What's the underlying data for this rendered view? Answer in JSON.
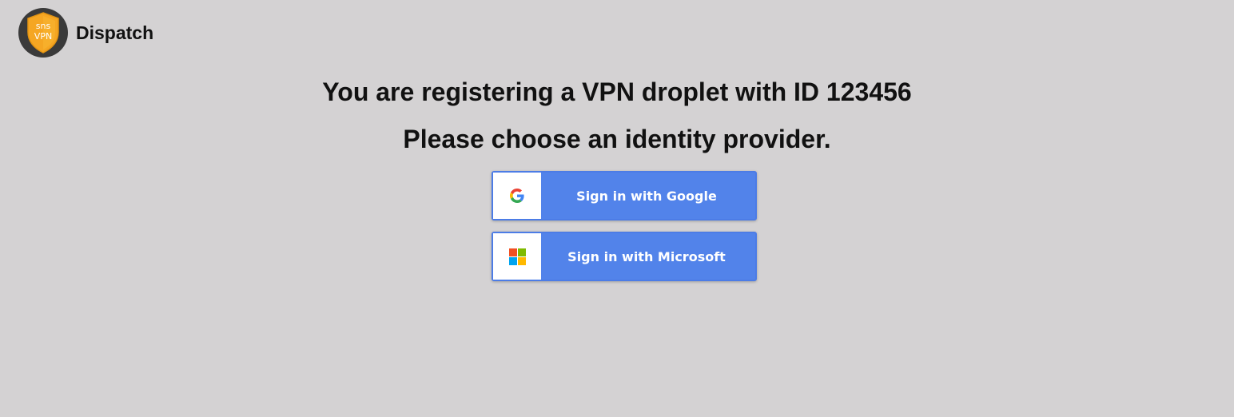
{
  "header": {
    "logo_text_top": "sns",
    "logo_text_bottom": "VPN",
    "app_name": "Dispatch"
  },
  "main": {
    "title": "You are registering a VPN droplet with ID 123456",
    "subtitle": "Please choose an identity provider."
  },
  "providers": [
    {
      "label": "Sign in with Google",
      "icon": "google-g-icon"
    },
    {
      "label": "Sign in with Microsoft",
      "icon": "microsoft-logo-icon"
    }
  ],
  "colors": {
    "background": "#d4d2d3",
    "button": "#5283ea",
    "logo_circle": "#3a3a3a",
    "shield": "#f5a623"
  }
}
